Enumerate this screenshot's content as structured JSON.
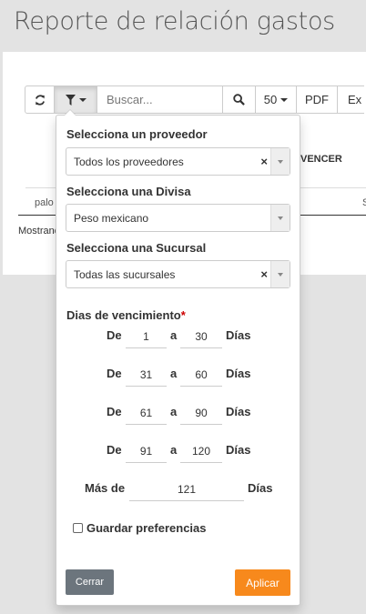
{
  "page": {
    "title": "Reporte de relación gastos"
  },
  "toolbar": {
    "search_placeholder": "Buscar...",
    "page_size": "50",
    "pdf_label": "PDF",
    "export_label": "Ex"
  },
  "table_bg": {
    "col_header": "VENCER",
    "cell_text": "palo",
    "cell_right": "S",
    "footer_text": "Mostrand"
  },
  "filter": {
    "proveedor": {
      "label": "Selecciona un proveedor",
      "value": "Todos los proveedores"
    },
    "divisa": {
      "label": "Selecciona una Divisa",
      "value": "Peso mexicano"
    },
    "sucursal": {
      "label": "Selecciona una Sucursal",
      "value": "Todas las sucursales"
    },
    "vencimiento": {
      "label": "Dias de vencimiento",
      "required_mark": "*",
      "from_word": "De",
      "to_word": "a",
      "unit": "Días",
      "ranges": [
        {
          "from": "1",
          "to": "30"
        },
        {
          "from": "31",
          "to": "60"
        },
        {
          "from": "61",
          "to": "90"
        },
        {
          "from": "91",
          "to": "120"
        }
      ],
      "more_than_label": "Más de",
      "more_than_value": "121"
    },
    "save_prefs_label": "Guardar preferencias",
    "close_label": "Cerrar",
    "apply_label": "Aplicar"
  },
  "colors": {
    "apply": "#f7891c",
    "close": "#6c757d"
  }
}
